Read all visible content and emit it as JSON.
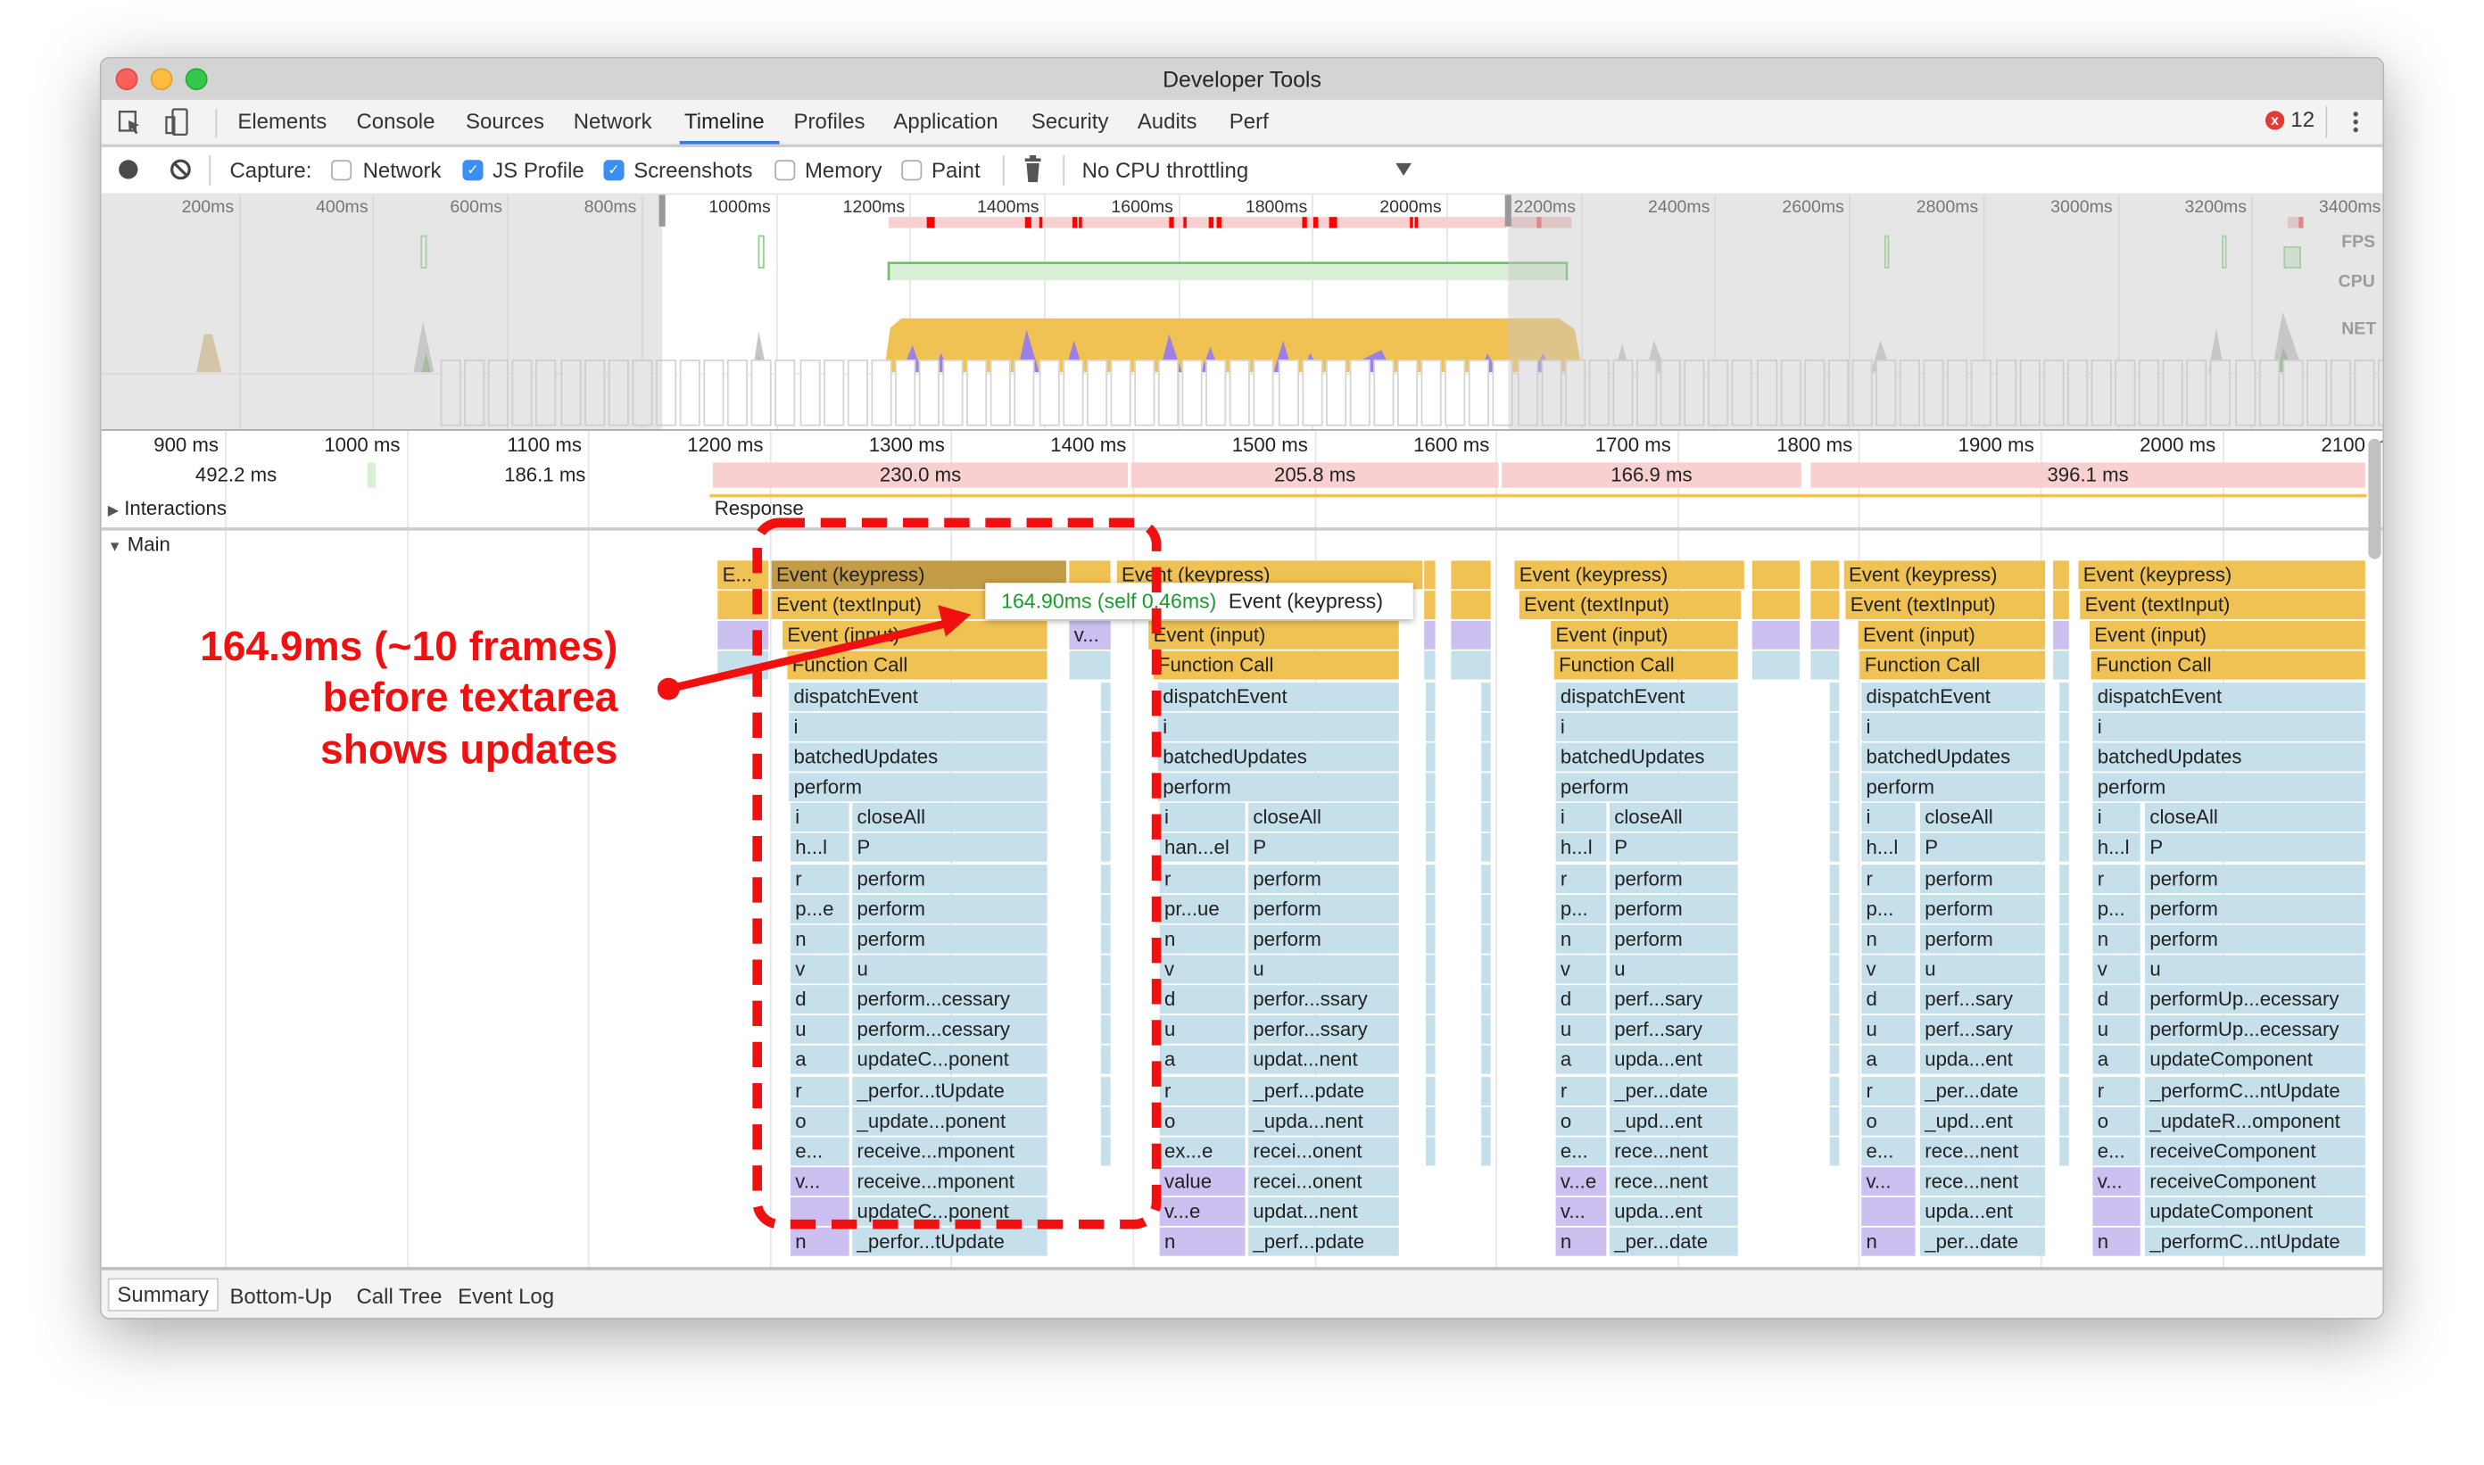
{
  "window": {
    "title": "Developer Tools"
  },
  "tabs": [
    {
      "label": "Elements"
    },
    {
      "label": "Console"
    },
    {
      "label": "Sources"
    },
    {
      "label": "Network"
    },
    {
      "label": "Timeline",
      "active": true
    },
    {
      "label": "Profiles"
    },
    {
      "label": "Application"
    },
    {
      "label": "Security"
    },
    {
      "label": "Audits"
    },
    {
      "label": "Perf"
    }
  ],
  "errors": {
    "count": "12"
  },
  "toolbar": {
    "capture_label": "Capture:",
    "options": [
      {
        "label": "Network",
        "checked": false
      },
      {
        "label": "JS Profile",
        "checked": true
      },
      {
        "label": "Screenshots",
        "checked": true
      },
      {
        "label": "Memory",
        "checked": false
      },
      {
        "label": "Paint",
        "checked": false
      }
    ],
    "throttling": "No CPU throttling"
  },
  "overview": {
    "ticks": [
      "200ms",
      "400ms",
      "600ms",
      "800ms",
      "1000ms",
      "1200ms",
      "1400ms",
      "1600ms",
      "1800ms",
      "2000ms",
      "2200ms",
      "2400ms",
      "2600ms",
      "2800ms",
      "3000ms",
      "3200ms",
      "3400ms"
    ],
    "lanes": [
      "FPS",
      "CPU",
      "NET"
    ],
    "selection_ms": [
      850,
      2110
    ]
  },
  "flame_ruler": {
    "ticks": [
      "900 ms",
      "1000 ms",
      "1100 ms",
      "1200 ms",
      "1300 ms",
      "1400 ms",
      "1500 ms",
      "1600 ms",
      "1700 ms",
      "1800 ms",
      "1900 ms",
      "2000 ms",
      "2100 ms"
    ]
  },
  "frames": [
    {
      "label": "492.2 ms",
      "long": false
    },
    {
      "label": "186.1 ms",
      "long": false
    },
    {
      "label": "230.0 ms",
      "long": true
    },
    {
      "label": "205.8 ms",
      "long": true
    },
    {
      "label": "166.9 ms",
      "long": true
    },
    {
      "label": "396.1 ms",
      "long": true
    }
  ],
  "interactions": {
    "label": "Interactions",
    "response": "Response"
  },
  "main": {
    "label": "Main"
  },
  "flame": {
    "extras": {
      "first_event": "E...",
      "side_call": "v..."
    },
    "columns": [
      {
        "top": [
          "Event (keypress)",
          "Event (textInput)",
          "Event (input)",
          "Function Call",
          "dispatchEvent",
          "i",
          "batchedUpdates",
          "perform"
        ],
        "pairs": [
          [
            "i",
            "closeAll"
          ],
          [
            "h...l",
            "P"
          ],
          [
            "r",
            "perform"
          ],
          [
            "p...e",
            "perform"
          ],
          [
            "n",
            "perform"
          ],
          [
            "v",
            "u"
          ],
          [
            "d",
            "perform...cessary"
          ],
          [
            "u",
            "perform...cessary"
          ],
          [
            "a",
            "updateC...ponent"
          ],
          [
            "r",
            "_perfor...tUpdate"
          ],
          [
            "o",
            "_update...ponent"
          ],
          [
            "e...",
            "receive...mponent"
          ],
          [
            "v...",
            "receive...mponent"
          ],
          [
            "",
            "updateC...ponent"
          ],
          [
            "n",
            "_perfor...tUpdate"
          ]
        ]
      },
      {
        "top": [
          "Event (keypress)",
          "Event (textInput)",
          "Event (input)",
          "Function Call",
          "dispatchEvent",
          "i",
          "batchedUpdates",
          "perform"
        ],
        "pairs": [
          [
            "i",
            "closeAll"
          ],
          [
            "han...el",
            "P"
          ],
          [
            "r",
            "perform"
          ],
          [
            "pr...ue",
            "perform"
          ],
          [
            "n",
            "perform"
          ],
          [
            "v",
            "u"
          ],
          [
            "d",
            "perfor...ssary"
          ],
          [
            "u",
            "perfor...ssary"
          ],
          [
            "a",
            "updat...nent"
          ],
          [
            "r",
            "_perf...pdate"
          ],
          [
            "o",
            "_upda...nent"
          ],
          [
            "ex...e",
            "recei...onent"
          ],
          [
            "value",
            "recei...onent"
          ],
          [
            "v...e",
            "updat...nent"
          ],
          [
            "n",
            "_perf...pdate"
          ]
        ]
      },
      {
        "top": [
          "Event (keypress)",
          "Event (textInput)",
          "Event (input)",
          "Function Call",
          "dispatchEvent",
          "i",
          "batchedUpdates",
          "perform"
        ],
        "pairs": [
          [
            "i",
            "closeAll"
          ],
          [
            "h...l",
            "P"
          ],
          [
            "r",
            "perform"
          ],
          [
            "p...",
            "perform"
          ],
          [
            "n",
            "perform"
          ],
          [
            "v",
            "u"
          ],
          [
            "d",
            "perf...sary"
          ],
          [
            "u",
            "perf...sary"
          ],
          [
            "a",
            "upda...ent"
          ],
          [
            "r",
            "_per...date"
          ],
          [
            "o",
            "_upd...ent"
          ],
          [
            "e...",
            "rece...nent"
          ],
          [
            "v...e",
            "rece...nent"
          ],
          [
            "v...",
            "upda...ent"
          ],
          [
            "n",
            "_per...date"
          ]
        ]
      },
      {
        "top": [
          "Event (keypress)",
          "Event (textInput)",
          "Event (input)",
          "Function Call",
          "dispatchEvent",
          "i",
          "batchedUpdates",
          "perform"
        ],
        "pairs": [
          [
            "i",
            "closeAll"
          ],
          [
            "h...l",
            "P"
          ],
          [
            "r",
            "perform"
          ],
          [
            "p...",
            "perform"
          ],
          [
            "n",
            "perform"
          ],
          [
            "v",
            "u"
          ],
          [
            "d",
            "perf...sary"
          ],
          [
            "u",
            "perf...sary"
          ],
          [
            "a",
            "upda...ent"
          ],
          [
            "r",
            "_per...date"
          ],
          [
            "o",
            "_upd...ent"
          ],
          [
            "e...",
            "rece...nent"
          ],
          [
            "v...",
            "rece...nent"
          ],
          [
            "",
            "upda...ent"
          ],
          [
            "n",
            "_per...date"
          ]
        ]
      },
      {
        "top": [
          "Event (keypress)",
          "Event (textInput)",
          "Event (input)",
          "Function Call",
          "dispatchEvent",
          "i",
          "batchedUpdates",
          "perform"
        ],
        "pairs": [
          [
            "i",
            "closeAll"
          ],
          [
            "h...l",
            "P"
          ],
          [
            "r",
            "perform"
          ],
          [
            "p...",
            "perform"
          ],
          [
            "n",
            "perform"
          ],
          [
            "v",
            "u"
          ],
          [
            "d",
            "performUp...ecessary"
          ],
          [
            "u",
            "performUp...ecessary"
          ],
          [
            "a",
            "updateComponent"
          ],
          [
            "r",
            "_performC...ntUpdate"
          ],
          [
            "o",
            "_updateR...omponent"
          ],
          [
            "e...",
            "receiveComponent"
          ],
          [
            "v...",
            "receiveComponent"
          ],
          [
            "",
            "updateComponent"
          ],
          [
            "n",
            "_performC...ntUpdate"
          ]
        ]
      }
    ]
  },
  "tooltip": {
    "duration": "164.90ms (self 0.46ms)",
    "name": "Event (keypress)"
  },
  "annotation": {
    "lines": [
      "164.9ms (~10 frames)",
      "before textarea",
      "shows updates"
    ]
  },
  "bottom_tabs": [
    {
      "label": "Summary",
      "active": true
    },
    {
      "label": "Bottom-Up"
    },
    {
      "label": "Call Tree"
    },
    {
      "label": "Event Log"
    }
  ],
  "colors": {
    "scripting": "#f0c254",
    "js_frame": "#c6e0eb",
    "gc": "#cbc0ef",
    "long_frame": "#f9d0d0",
    "annotation": "#f01010",
    "accent": "#3879d9"
  }
}
